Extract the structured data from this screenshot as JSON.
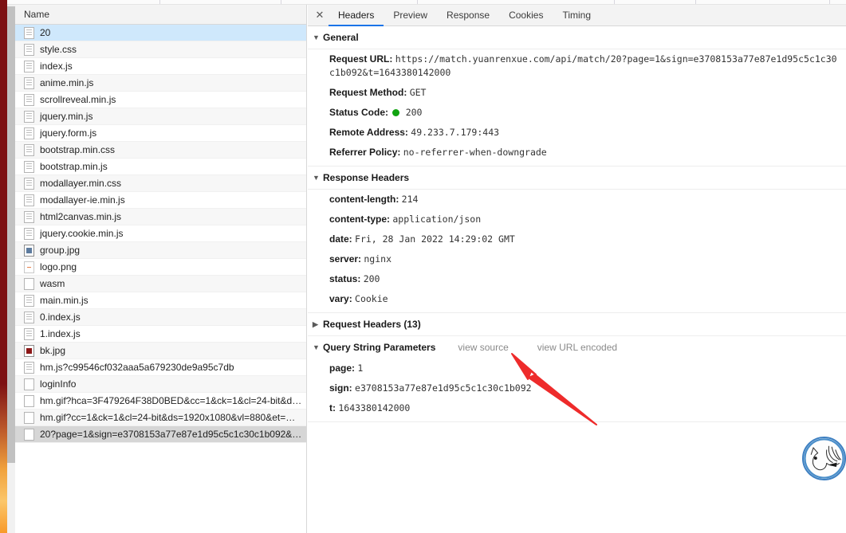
{
  "list_panel": {
    "column_header": "Name",
    "rows": [
      {
        "name": "20",
        "icon": "document-icon",
        "state": "selected"
      },
      {
        "name": "style.css",
        "icon": "document-icon",
        "state": "normal"
      },
      {
        "name": "index.js",
        "icon": "document-icon",
        "state": "normal"
      },
      {
        "name": "anime.min.js",
        "icon": "document-icon",
        "state": "normal"
      },
      {
        "name": "scrollreveal.min.js",
        "icon": "document-icon",
        "state": "normal"
      },
      {
        "name": "jquery.min.js",
        "icon": "document-icon",
        "state": "normal"
      },
      {
        "name": "jquery.form.js",
        "icon": "document-icon",
        "state": "normal"
      },
      {
        "name": "bootstrap.min.css",
        "icon": "document-icon",
        "state": "normal"
      },
      {
        "name": "bootstrap.min.js",
        "icon": "document-icon",
        "state": "normal"
      },
      {
        "name": "modallayer.min.css",
        "icon": "document-icon",
        "state": "normal"
      },
      {
        "name": "modallayer-ie.min.js",
        "icon": "document-icon",
        "state": "normal"
      },
      {
        "name": "html2canvas.min.js",
        "icon": "document-icon",
        "state": "normal"
      },
      {
        "name": "jquery.cookie.min.js",
        "icon": "document-icon",
        "state": "normal"
      },
      {
        "name": "group.jpg",
        "icon": "image-icon",
        "state": "normal"
      },
      {
        "name": "logo.png",
        "icon": "image-orange-icon",
        "state": "normal"
      },
      {
        "name": "wasm",
        "icon": "plain-icon",
        "state": "normal"
      },
      {
        "name": "main.min.js",
        "icon": "document-icon",
        "state": "normal"
      },
      {
        "name": "0.index.js",
        "icon": "document-icon",
        "state": "normal"
      },
      {
        "name": "1.index.js",
        "icon": "document-icon",
        "state": "normal"
      },
      {
        "name": "bk.jpg",
        "icon": "image-red-icon",
        "state": "normal"
      },
      {
        "name": "hm.js?c99546cf032aaa5a679230de9a95c7db",
        "icon": "document-icon",
        "state": "normal"
      },
      {
        "name": "loginInfo",
        "icon": "plain-icon",
        "state": "normal"
      },
      {
        "name": "hm.gif?hca=3F479264F38D0BED&cc=1&ck=1&cl=24-bit&ds…",
        "icon": "plain-icon",
        "state": "normal"
      },
      {
        "name": "hm.gif?cc=1&ck=1&cl=24-bit&ds=1920x1080&vl=880&et=…",
        "icon": "plain-icon",
        "state": "normal"
      },
      {
        "name": "20?page=1&sign=e3708153a77e87e1d95c5c1c30c1b092&t=…",
        "icon": "plain-icon",
        "state": "highlight"
      }
    ]
  },
  "detail_panel": {
    "close_icon": "✕",
    "tabs": [
      {
        "label": "Headers",
        "active": true
      },
      {
        "label": "Preview",
        "active": false
      },
      {
        "label": "Response",
        "active": false
      },
      {
        "label": "Cookies",
        "active": false
      },
      {
        "label": "Timing",
        "active": false
      }
    ],
    "general": {
      "title": "General",
      "caret": "▼",
      "request_url_key": "Request URL:",
      "request_url_value": "https://match.yuanrenxue.com/api/match/20?page=1&sign=e3708153a77e87e1d95c5c1c30c1b092&t=1643380142000",
      "request_method_key": "Request Method:",
      "request_method_value": "GET",
      "status_code_key": "Status Code:",
      "status_code_value": "200",
      "status_color": "#10a310",
      "remote_address_key": "Remote Address:",
      "remote_address_value": "49.233.7.179:443",
      "referrer_policy_key": "Referrer Policy:",
      "referrer_policy_value": "no-referrer-when-downgrade"
    },
    "response_headers": {
      "title": "Response Headers",
      "caret": "▼",
      "items": [
        {
          "key": "content-length:",
          "value": "214"
        },
        {
          "key": "content-type:",
          "value": "application/json"
        },
        {
          "key": "date:",
          "value": "Fri, 28 Jan 2022 14:29:02 GMT"
        },
        {
          "key": "server:",
          "value": "nginx"
        },
        {
          "key": "status:",
          "value": "200"
        },
        {
          "key": "vary:",
          "value": "Cookie"
        }
      ]
    },
    "request_headers": {
      "title": "Request Headers (13)",
      "caret": "▶"
    },
    "query_string": {
      "title": "Query String Parameters",
      "caret": "▼",
      "view_source_label": "view source",
      "view_url_encoded_label": "view URL encoded",
      "items": [
        {
          "key": "page:",
          "value": "1"
        },
        {
          "key": "sign:",
          "value": "e3708153a77e87e1d95c5c1c30c1b092"
        },
        {
          "key": "t:",
          "value": "1643380142000"
        }
      ]
    }
  },
  "annotation": {
    "arrow_color": "#ee2b2b",
    "arrow_name": "red-pointer-arrow"
  },
  "avatar": {
    "ring_color": "#3d7fc1",
    "name": "floating-avatar"
  }
}
